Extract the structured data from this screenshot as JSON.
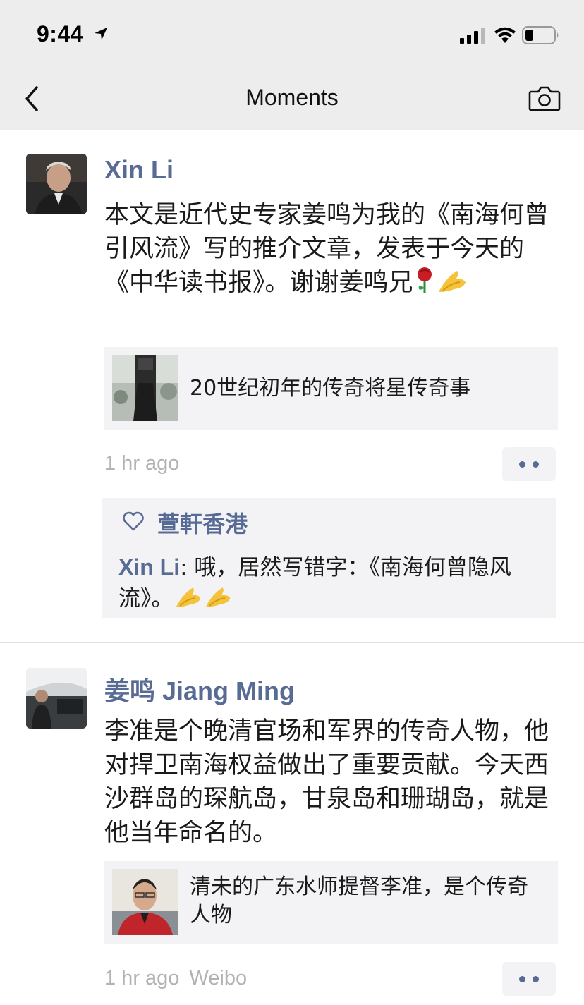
{
  "status_bar": {
    "time": "9:44"
  },
  "nav": {
    "title": "Moments"
  },
  "posts": [
    {
      "author": "Xin Li",
      "text": "本文是近代史专家姜鸣为我的《南海何曾引风流》写的推介文章，发表于今天的《中华读书报》。谢谢姜鸣兄",
      "text_emojis": [
        "rose",
        "folded-hands"
      ],
      "link_title": "20世纪初年的传奇将星传奇事",
      "time": "1 hr ago",
      "source": "",
      "likes": [
        "萱軒香港"
      ],
      "comments": [
        {
          "author": "Xin Li",
          "text": ": 哦，居然写错字：《南海何曾隐风流》。",
          "emojis": [
            "folded-hands",
            "folded-hands"
          ]
        }
      ]
    },
    {
      "author": "姜鸣 Jiang Ming",
      "text": "李准是个晚清官场和军界的传奇人物，他对捍卫南海权益做出了重要贡献。今天西沙群岛的琛航岛，甘泉岛和珊瑚岛，就是他当年命名的。",
      "link_title": "清未的广东水师提督李准，是个传奇人物",
      "time": "1 hr ago",
      "source": "Weibo"
    }
  ],
  "colors": {
    "link_blue": "#576b95",
    "card_bg": "#f3f3f5",
    "nav_bg": "#ededed",
    "meta_gray": "#b2b2b2"
  },
  "icons": [
    "location-arrow-icon",
    "signal-icon",
    "wifi-icon",
    "battery-icon",
    "back-chevron-icon",
    "camera-icon",
    "heart-icon",
    "more-dots-icon",
    "rose-emoji",
    "folded-hands-emoji"
  ]
}
